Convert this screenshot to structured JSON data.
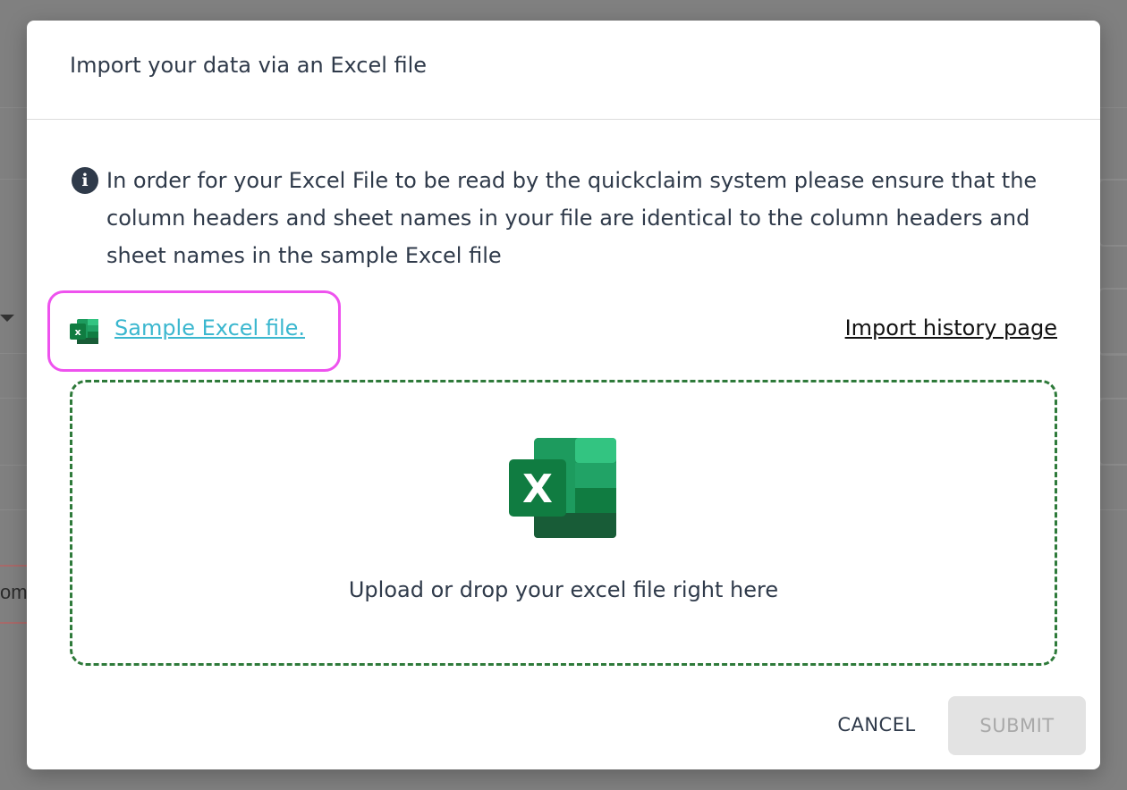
{
  "modal": {
    "title": "Import your data via an Excel file"
  },
  "info": {
    "icon": "info-icon",
    "text": "In order for your Excel File to be read by the quickclaim system please ensure that the column headers and sheet names in your file are identical to the column headers and sheet names in the sample Excel file"
  },
  "links": {
    "sample_label": "Sample Excel file.",
    "sample_icon": "excel-icon",
    "history_label": "Import history page",
    "sample_color": "#3bb7cf",
    "highlight_color": "#ee52ee"
  },
  "dropzone": {
    "icon": "excel-icon",
    "text": "Upload or drop your excel file right here",
    "border_color": "#2e7a3a"
  },
  "actions": {
    "cancel_label": "CANCEL",
    "submit_label": "SUBMIT"
  },
  "background": {
    "partial_text": "om"
  }
}
